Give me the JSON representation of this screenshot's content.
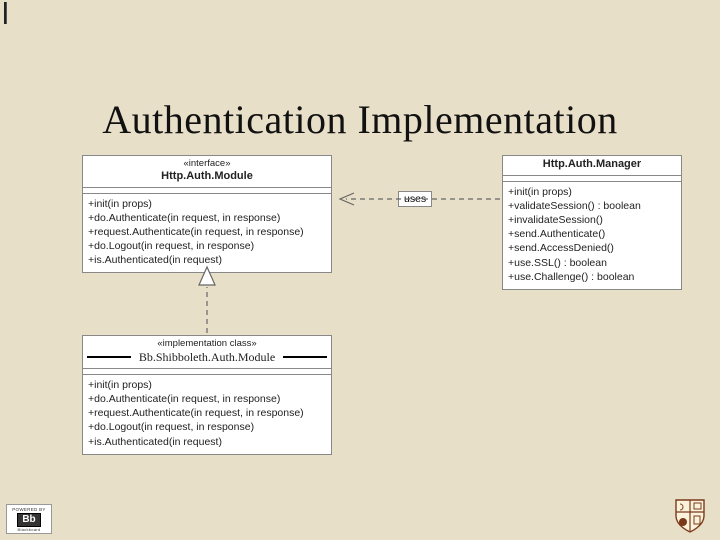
{
  "title": "Authentication Implementation",
  "connectors": {
    "uses_label": "uses"
  },
  "interface_box": {
    "stereotype": "«interface»",
    "name": "Http.Auth.Module",
    "ops": [
      "+init(in props)",
      "+do.Authenticate(in request, in response)",
      "+request.Authenticate(in request, in response)",
      "+do.Logout(in request, in response)",
      "+is.Authenticated(in request)"
    ]
  },
  "manager_box": {
    "name": "Http.Auth.Manager",
    "ops": [
      "+init(in props)",
      "+validateSession() : boolean",
      "+invalidateSession()",
      "+send.Authenticate()",
      "+send.AccessDenied()",
      "+use.SSL() : boolean",
      "+use.Challenge() : boolean"
    ]
  },
  "impl_box": {
    "stereotype": "«implementation class»",
    "name": "Bb.Shibboleth.Auth.Module",
    "ops": [
      "+init(in props)",
      "+do.Authenticate(in request, in response)",
      "+request.Authenticate(in request, in response)",
      "+do.Logout(in request, in response)",
      "+is.Authenticated(in request)"
    ]
  },
  "badges": {
    "powered": "POWERED BY",
    "bb": "Bb",
    "blackboard": "Blackboard"
  }
}
